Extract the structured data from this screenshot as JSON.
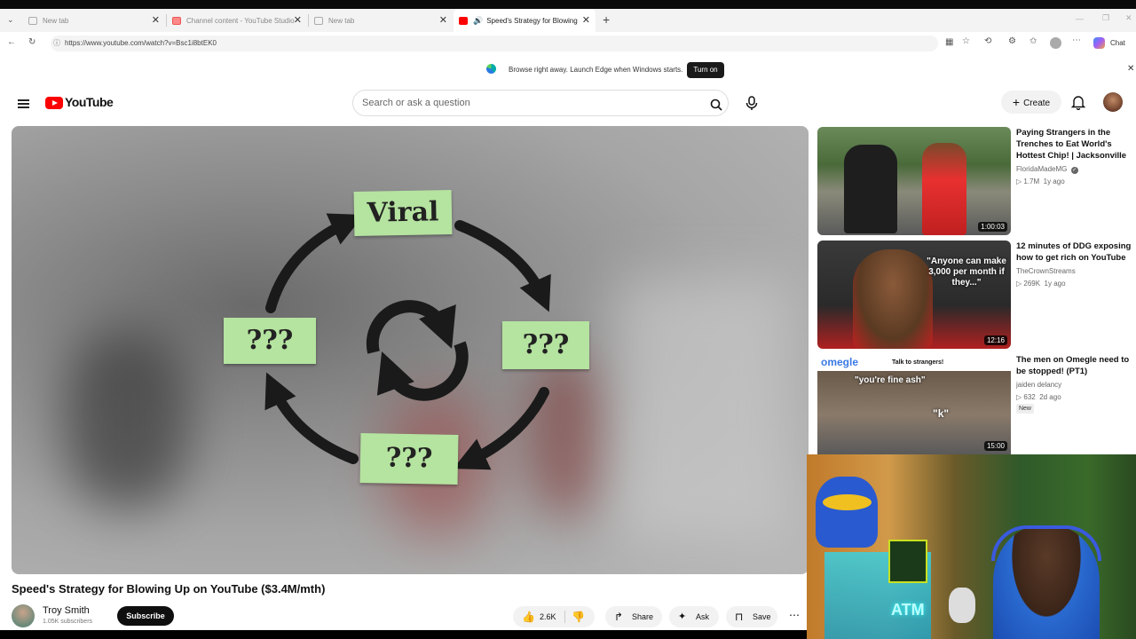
{
  "browser": {
    "tabs": [
      {
        "label": "New tab",
        "active": false
      },
      {
        "label": "Channel content - YouTube Studio",
        "active": false
      },
      {
        "label": "New tab",
        "active": false
      },
      {
        "label": "Speed's Strategy for Blowing U",
        "active": true
      }
    ],
    "url": "https://www.youtube.com/watch?v=Bsc1i8btEK0",
    "chat_label": "Chat"
  },
  "notice": {
    "text": "Browse right away. Launch Edge when Windows starts.",
    "button": "Turn on"
  },
  "youtube": {
    "logo": "YouTube",
    "search_placeholder": "Search or ask a question",
    "create_label": "Create"
  },
  "video": {
    "notes": {
      "top": "Viral",
      "left": "???",
      "right": "???",
      "bottom": "???"
    },
    "title": "Speed's Strategy for Blowing Up on YouTube ($3.4M/mth)",
    "channel": "Troy Smith",
    "subscribers": "1.05K subscribers",
    "subscribe_label": "Subscribe",
    "likes": "2.6K",
    "share_label": "Share",
    "ask_label": "Ask",
    "save_label": "Save"
  },
  "sidebar": [
    {
      "title": "Paying Strangers in the Trenches to Eat World's Hottest Chip! | Jacksonville",
      "channel": "FloridaMadeMG",
      "verified": true,
      "views": "1.7M",
      "age": "1y ago",
      "duration": "1:00:03",
      "badge": ""
    },
    {
      "title": "12 minutes of DDG exposing how to get rich on YouTube",
      "channel": "TheCrownStreams",
      "verified": false,
      "views": "269K",
      "age": "1y ago",
      "duration": "12:16",
      "badge": "",
      "thumb_quote": "\"Anyone can make 3,000 per month if they...\""
    },
    {
      "title": "The men on Omegle need to be stopped! (PT1)",
      "channel": "jaiden delancy",
      "verified": false,
      "views": "632",
      "age": "2d ago",
      "duration": "15:00",
      "badge": "New",
      "thumb_brand": "omegle",
      "thumb_tagline": "Talk to strangers!",
      "thumb_caption1": "\"you're fine ash\"",
      "thumb_caption2": "\"k\""
    }
  ],
  "webcam": {
    "sign_text": "ATM"
  }
}
